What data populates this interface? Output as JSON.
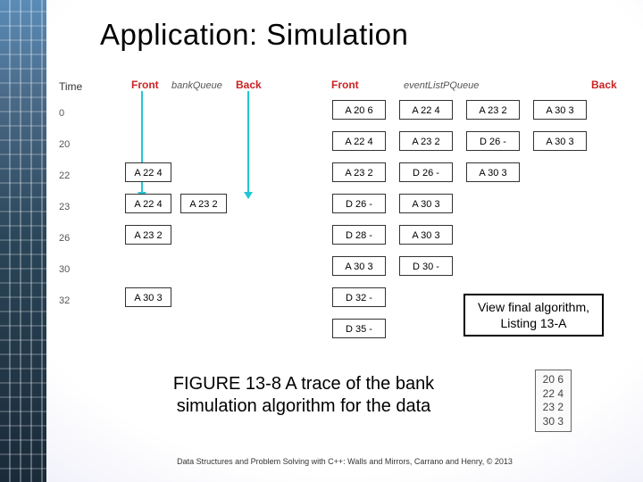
{
  "title": "Application: Simulation",
  "headers": {
    "time": "Time",
    "bankFront": "Front",
    "bankLabel": "bankQueue",
    "bankBack": "Back",
    "eventFront": "Front",
    "eventLabel": "eventListPQueue",
    "eventBack": "Back"
  },
  "times": [
    "0",
    "20",
    "22",
    "23",
    "26",
    "30",
    "32"
  ],
  "rows": [
    {
      "bank": [],
      "event": [
        "A 20 6",
        "A 22 4",
        "A 23 2",
        "A 30 3"
      ]
    },
    {
      "bank": [],
      "event": [
        "A 22 4",
        "A 23 2",
        "D 26 -",
        "A 30 3"
      ]
    },
    {
      "bank": [
        "A 22 4"
      ],
      "event": [
        "A 23 2",
        "D 26 -",
        "A 30 3"
      ]
    },
    {
      "bank": [
        "A 22 4",
        "A 23 2"
      ],
      "event": [
        "D 26 -",
        "A 30 3"
      ]
    },
    {
      "bank": [
        "A 23 2"
      ],
      "event": [
        "D 28 -",
        "A 30 3"
      ]
    },
    {
      "bank": [],
      "event": [
        "A 30 3",
        "D 30 -"
      ]
    },
    {
      "bank": [
        "A 30 3"
      ],
      "event": [
        "D 32 -"
      ]
    },
    {
      "bank": [],
      "event": [
        "D 35 -"
      ]
    }
  ],
  "linkBox": {
    "line1": "View final algorithm,",
    "line2": "Listing 13-A"
  },
  "caption": "FIGURE 13-8 A trace of the bank simulation algorithm for the data",
  "inputData": [
    "20 6",
    "22 4",
    "23 2",
    "30 3"
  ],
  "footer": "Data Structures and Problem Solving with C++: Walls and Mirrors, Carrano and Henry, © 2013"
}
